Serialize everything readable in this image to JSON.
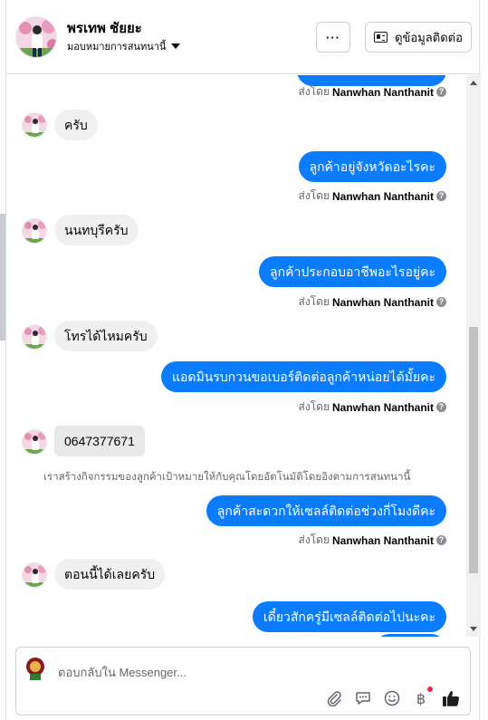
{
  "header": {
    "name": "พรเทพ ชัยยะ",
    "assign_label": "มอบหมายการสนทนานี้",
    "more_label": "···",
    "contact_label": "ดูข้อมูลติดต่อ"
  },
  "sent_by": {
    "prefix": "ส่งโดย",
    "agent": "Nanwhan Nanthanit",
    "help": "?"
  },
  "messages": {
    "in1": "ครับ",
    "out1": "ลูกค้าอยู่จังหวัดอะไรคะ",
    "in2": "นนทบุรีครับ",
    "out2": "ลูกค้าประกอบอาชีพอะไรอยู่คะ",
    "in3": "โทรได้ไหมครับ",
    "out3": "แอดมินรบกวนขอเบอร์ติดต่อลูกค้าหน่อยได้มั้ยคะ",
    "in4": "0647377671",
    "system_note": "เราสร้างกิจกรรมของลูกค้าเป้าหมายให้กับคุณโดยอัตโนมัติโดยอิงตามการสนทนานี้",
    "out4": "ลูกค้าสะดวกให้เซลล์ติดต่อช่วงกี่โมงดีคะ",
    "in5": "ตอนนี้ได้เลยครับ",
    "out5": "เดี๋ยวสักครู่มีเซลล์ติดต่อไปนะคะ"
  },
  "composer": {
    "placeholder": "ตอบกลับใน Messenger..."
  },
  "colors": {
    "outgoing_bubble": "#0a7cff",
    "incoming_bubble": "#f0f0f0",
    "like": "#1c1e21",
    "notification_dot": "#f02849"
  },
  "icons": [
    "attachment-icon",
    "saved-replies-icon",
    "emoji-icon",
    "payment-icon",
    "thumbs-up-icon",
    "help-icon"
  ]
}
